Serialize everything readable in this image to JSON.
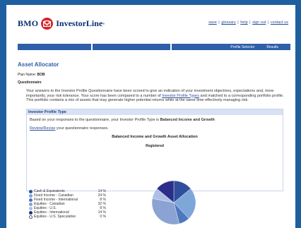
{
  "brand": {
    "bank": "BMO",
    "product": "InvestorLine",
    "tm": "®"
  },
  "top_links": [
    "save",
    "glossary",
    "help",
    "sign out",
    "contact us"
  ],
  "nav": {
    "items": [
      "Profile Selector",
      "Results"
    ]
  },
  "page": {
    "title": "Asset Allocator",
    "plan_label": "Plan Name:",
    "plan_name": "BOB",
    "questionnaire_label": "Questionnaire",
    "intro_part1": "Your answers to the Investor Profile Questionnaire have been scored to give an indication of your investment objectives, expectations and, more importantly, your risk tolerance. Your score has been compared to a number of ",
    "intro_link": "Investor Profile Types",
    "intro_part2": " and matched to a corresponding portfolio profile. This portfolio contains a mix of assets that may generate higher potential returns while at the same time effectively managing risk."
  },
  "profile_box": {
    "header": "Investor Profile Type",
    "result_prefix": "Based on your responses to the questionnaire, your Investor Profile Type is ",
    "result_type": "Balanced Income and Growth",
    "review_link": "Review/Revise",
    "review_suffix": " your questionnaire responses.",
    "allocation_title": "Balanced Income and Growth Asset Allocation",
    "account_label": "Registered"
  },
  "chart_data": {
    "type": "pie",
    "title": "Balanced Income and Growth Asset Allocation",
    "subtitle": "Registered",
    "slices": [
      {
        "label": "Cash & Equivalents",
        "value": 14,
        "display": "14 %",
        "color": "#2f4f9c"
      },
      {
        "label": "Fixed Income - Canadian",
        "value": 24,
        "display": "24 %",
        "color": "#7fa6d9"
      },
      {
        "label": "Fixed Income - International",
        "value": 8,
        "display": "8 %",
        "color": "#4f77bd"
      },
      {
        "label": "Equities - Canadian",
        "value": 32,
        "display": "32 %",
        "color": "#8aa3d2"
      },
      {
        "label": "Equities - U.S.",
        "value": 8,
        "display": "8 %",
        "color": "#aebfe3"
      },
      {
        "label": "Equities - International",
        "value": 14,
        "display": "14 %",
        "color": "#2b2f8a"
      },
      {
        "label": "Equities - U.S. Speculative",
        "value": 0,
        "display": "0 %",
        "color": "#ffffff"
      }
    ]
  }
}
